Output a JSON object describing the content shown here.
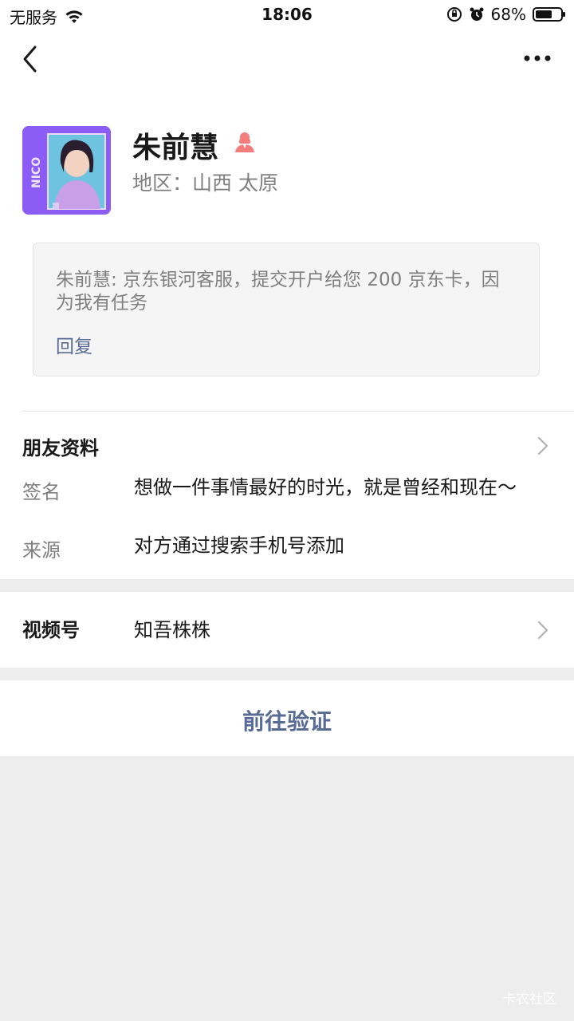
{
  "status_bar": {
    "carrier": "无服务",
    "time": "18:06",
    "battery": "68%",
    "battery_level": 0.68
  },
  "nav": {
    "back_icon": "chevron-left-icon",
    "more_icon": "more-dots-icon"
  },
  "profile": {
    "name": "朱前慧",
    "gender_icon": "female-user-icon",
    "region": "地区：山西 太原",
    "avatar_text": "NICO",
    "message": {
      "text": "朱前慧: 京东银河客服，提交开户给您 200 京东卡，因为我有任务",
      "reply_label": "回复"
    }
  },
  "friend_info": {
    "title": "朋友资料",
    "rows": [
      {
        "label": "签名",
        "value": "想做一件事情最好的时光，就是曾经和现在～"
      },
      {
        "label": "来源",
        "value": "对方通过搜索手机号添加"
      }
    ]
  },
  "channel": {
    "label": "视频号",
    "value": "知吾株株"
  },
  "action": {
    "label": "前往验证"
  },
  "watermark": "卡农社区",
  "colors": {
    "link": "#576b95",
    "background": "#ededed",
    "avatar": "#8b5cf6"
  }
}
